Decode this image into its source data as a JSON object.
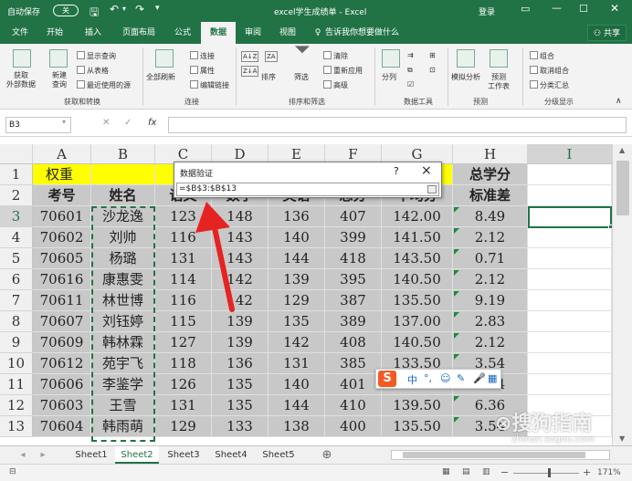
{
  "titlebar": {
    "autosave_label": "自动保存",
    "autosave_state": "关",
    "title": "excel学生成绩单 - Excel",
    "login": "登录"
  },
  "menu": {
    "tabs": [
      "文件",
      "开始",
      "插入",
      "页面布局",
      "公式",
      "数据",
      "审阅",
      "视图"
    ],
    "active_index": 5,
    "tell_me": "告诉我你想要做什么",
    "share": "共享"
  },
  "ribbon": {
    "get_external": "获取\n外部数据",
    "new_query": "新建\n查询",
    "show_query": "显示查询",
    "from_table": "从表格",
    "recent_sources": "最近使用的源",
    "refresh_all": "全部刷新",
    "connections": "连接",
    "properties": "属性",
    "edit_links": "编辑链接",
    "sort": "排序",
    "filter": "筛选",
    "clear": "清除",
    "reapply": "重新应用",
    "advanced": "高级",
    "text_to_columns": "分列",
    "what_if": "模拟分析",
    "forecast_sheet": "预测\n工作表",
    "group": "组合",
    "ungroup": "取消组合",
    "subtotal": "分类汇总",
    "groups": {
      "get_transform": "获取和转换",
      "connections": "连接",
      "sort_filter": "排序和筛选",
      "data_tools": "数据工具",
      "forecast": "预测",
      "outline": "分级显示"
    }
  },
  "formula_bar": {
    "name_box": "B3",
    "fx": "fx",
    "value": ""
  },
  "columns": [
    "A",
    "B",
    "C",
    "D",
    "E",
    "F",
    "G",
    "H",
    "I"
  ],
  "rows": [
    [
      "权重",
      "",
      "",
      "",
      "",
      "",
      "",
      "总学分"
    ],
    [
      "考号",
      "姓名",
      "语文",
      "数学",
      "英语",
      "总分",
      "平均分",
      "标准差"
    ],
    [
      "70601",
      "沙龙逸",
      "123",
      "148",
      "136",
      "407",
      "142.00",
      "8.49"
    ],
    [
      "70602",
      "刘帅",
      "116",
      "143",
      "140",
      "399",
      "141.50",
      "2.12"
    ],
    [
      "70605",
      "杨璐",
      "131",
      "143",
      "144",
      "418",
      "143.50",
      "0.71"
    ],
    [
      "70616",
      "康惠雯",
      "114",
      "142",
      "139",
      "395",
      "140.50",
      "2.12"
    ],
    [
      "70611",
      "林世博",
      "116",
      "142",
      "129",
      "387",
      "135.50",
      "9.19"
    ],
    [
      "70607",
      "刘钰婷",
      "115",
      "139",
      "135",
      "389",
      "137.00",
      "2.83"
    ],
    [
      "70609",
      "韩林霖",
      "127",
      "139",
      "142",
      "408",
      "140.50",
      "2.12"
    ],
    [
      "70612",
      "苑宇飞",
      "118",
      "136",
      "131",
      "385",
      "133.50",
      "3.54"
    ],
    [
      "70606",
      "李鉴学",
      "126",
      "135",
      "140",
      "401",
      "137.50",
      "3.54"
    ],
    [
      "70603",
      "王雪",
      "131",
      "135",
      "144",
      "410",
      "139.50",
      "6.36"
    ],
    [
      "70604",
      "韩雨萌",
      "129",
      "133",
      "138",
      "400",
      "135.50",
      "3.54"
    ]
  ],
  "dialog": {
    "title": "数据验证",
    "help": "?",
    "close": "×",
    "input": "=$B$3:$B$13"
  },
  "ime": {
    "logo": "S",
    "mode": "中"
  },
  "sheets": {
    "tabs": [
      "Sheet1",
      "Sheet2",
      "Sheet3",
      "Sheet4",
      "Sheet5"
    ],
    "active_index": 1,
    "add": "⊕"
  },
  "status": {
    "zoom": "171%"
  },
  "watermark": {
    "brand": "搜狗指南",
    "url": "zhinan.sogou.com"
  },
  "colors": {
    "excel_green": "#217346",
    "highlight_yellow": "#ffff00",
    "arrow_red": "#e62323"
  }
}
